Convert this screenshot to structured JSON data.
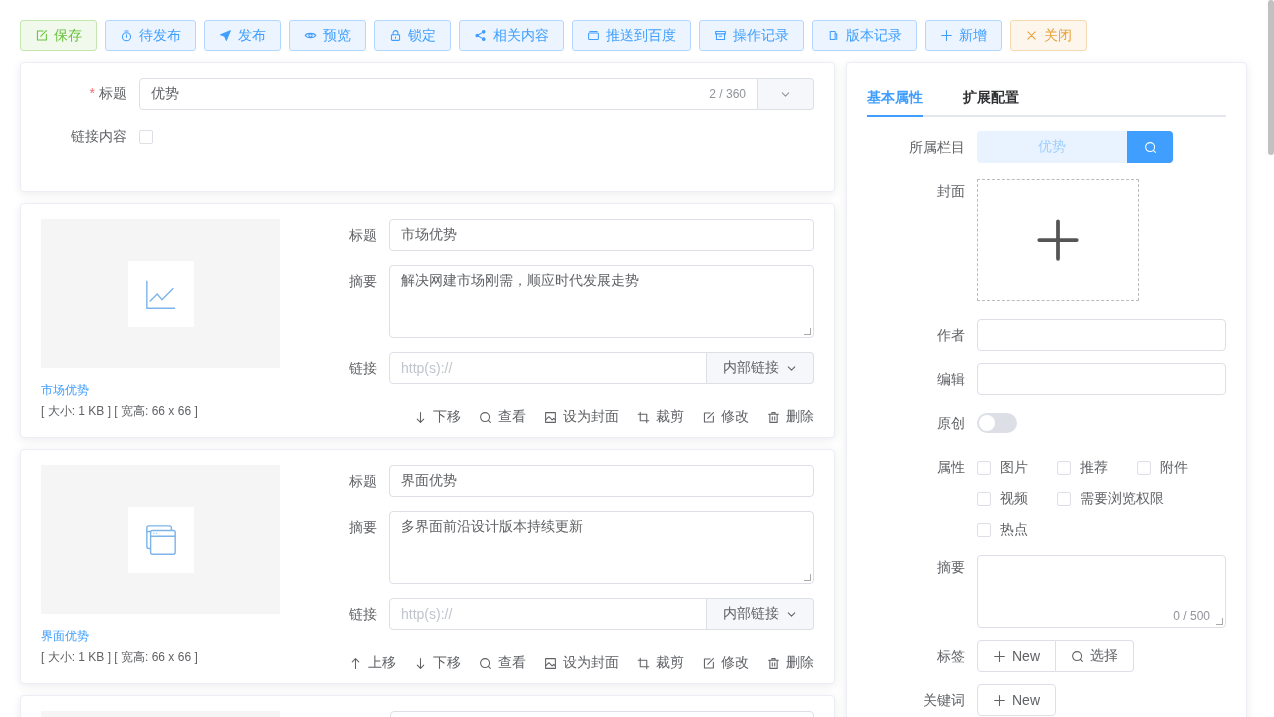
{
  "toolbar": [
    {
      "label": "保存",
      "color": "#67c23a",
      "kind": "edit"
    },
    {
      "label": "待发布",
      "color": "#409eff",
      "kind": "timer"
    },
    {
      "label": "发布",
      "color": "#409eff",
      "kind": "send"
    },
    {
      "label": "预览",
      "color": "#409eff",
      "kind": "eye"
    },
    {
      "label": "锁定",
      "color": "#409eff",
      "kind": "lock"
    },
    {
      "label": "相关内容",
      "color": "#409eff",
      "kind": "share"
    },
    {
      "label": "推送到百度",
      "color": "#409eff",
      "kind": "box"
    },
    {
      "label": "操作记录",
      "color": "#409eff",
      "kind": "archive"
    },
    {
      "label": "版本记录",
      "color": "#409eff",
      "kind": "tickets"
    },
    {
      "label": "新增",
      "color": "#409eff",
      "kind": "plus"
    },
    {
      "label": "关闭",
      "color": "#e6a23c",
      "kind": "close"
    }
  ],
  "main_form": {
    "required_mark": "*",
    "title_label": "标题",
    "title_value": "优势",
    "title_counter": "2 / 360",
    "link_label": "链接内容",
    "link_checked": false
  },
  "images": [
    {
      "kind": "chart",
      "name": "市场优势",
      "meta": "[ 大小: 1 KB ] [ 宽高: 66 x 66 ]",
      "fields": {
        "title_label": "标题",
        "title_value": "市场优势",
        "summary_label": "摘要",
        "summary_value": "解决网建市场刚需，顺应时代发展走势",
        "link_label": "链接",
        "link_placeholder": "http(s)://",
        "link_type": "内部链接"
      },
      "actions": [
        {
          "kind": "down",
          "label": "下移"
        },
        {
          "kind": "view",
          "label": "查看"
        },
        {
          "kind": "cover",
          "label": "设为封面"
        },
        {
          "kind": "crop",
          "label": "裁剪"
        },
        {
          "kind": "edit",
          "label": "修改"
        },
        {
          "kind": "delete",
          "label": "删除"
        }
      ]
    },
    {
      "kind": "window",
      "name": "界面优势",
      "meta": "[ 大小: 1 KB ] [ 宽高: 66 x 66 ]",
      "fields": {
        "title_label": "标题",
        "title_value": "界面优势",
        "summary_label": "摘要",
        "summary_value": "多界面前沿设计版本持续更新",
        "link_label": "链接",
        "link_placeholder": "http(s)://",
        "link_type": "内部链接"
      },
      "actions": [
        {
          "kind": "up",
          "label": "上移"
        },
        {
          "kind": "down",
          "label": "下移"
        },
        {
          "kind": "view",
          "label": "查看"
        },
        {
          "kind": "cover",
          "label": "设为封面"
        },
        {
          "kind": "crop",
          "label": "裁剪"
        },
        {
          "kind": "edit",
          "label": "修改"
        },
        {
          "kind": "delete",
          "label": "删除"
        }
      ]
    },
    {
      "kind": "stub"
    }
  ],
  "side_panel": {
    "tabs": [
      {
        "label": "基本属性",
        "selected": true
      },
      {
        "label": "扩展配置",
        "selected": false
      }
    ],
    "column_label": "所属栏目",
    "column_value": "优势",
    "cover_label": "封面",
    "author_label": "作者",
    "editor_label": "编辑",
    "original_label": "原创",
    "original_on": false,
    "attributes_label": "属性",
    "attributes": [
      {
        "label": "图片",
        "checked": false
      },
      {
        "label": "推荐",
        "checked": false
      },
      {
        "label": "附件",
        "checked": false
      },
      {
        "label": "视频",
        "checked": false
      },
      {
        "label": "需要浏览权限",
        "checked": false
      },
      {
        "label": "热点",
        "checked": false
      }
    ],
    "summary_label": "摘要",
    "summary_counter": "0 / 500",
    "tags_label": "标签",
    "tags_new": "New",
    "tags_select": "选择",
    "keywords_label": "关键词",
    "keywords_new": "New"
  }
}
